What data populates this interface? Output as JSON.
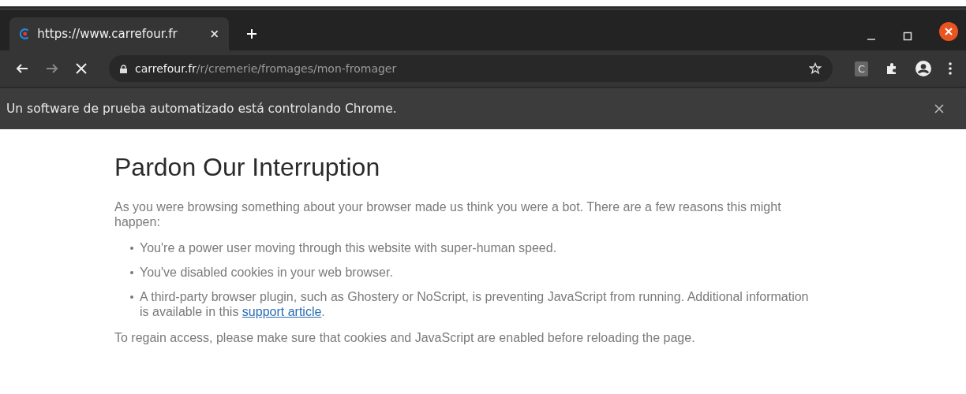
{
  "tab": {
    "title": "https://www.carrefour.fr",
    "selected": true
  },
  "toolbar": {
    "url_domain": "carrefour.fr",
    "url_path": "/r/cremerie/fromages/mon-fromager",
    "extension_label": "C"
  },
  "infobar": {
    "message": "Un software de prueba automatizado está controlando Chrome."
  },
  "page": {
    "heading": "Pardon Our Interruption",
    "intro": "As you were browsing something about your browser made us think you were a bot. There are a few reasons this might happen:",
    "reasons": [
      {
        "text": "You're a power user moving through this website with super-human speed."
      },
      {
        "text": "You've disabled cookies in your web browser."
      },
      {
        "text": "A third-party browser plugin, such as Ghostery or NoScript, is preventing JavaScript from running. Additional information is available in this ",
        "link": "support article",
        "after": "."
      }
    ],
    "outro": "To regain access, please make sure that cookies and JavaScript are enabled before reloading the page."
  }
}
